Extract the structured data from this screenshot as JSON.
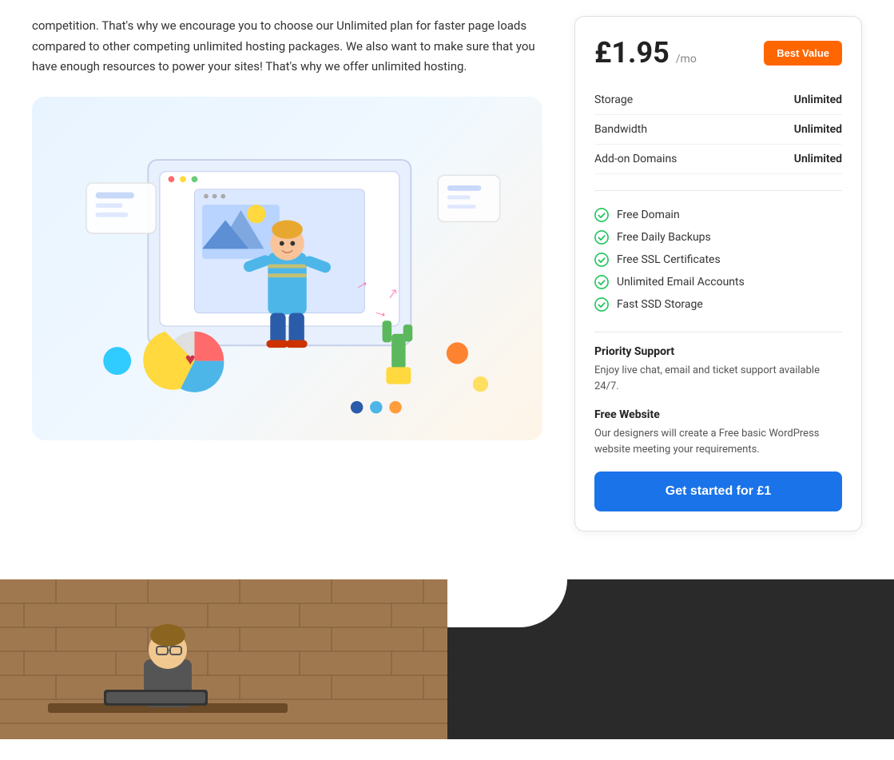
{
  "left": {
    "paragraph": "competition. That's why we encourage you to choose our Unlimited plan for faster page loads compared to other competing unlimited hosting packages. We also want to make sure that you have enough resources to power your sites! That's why we offer unlimited hosting."
  },
  "pricing": {
    "price": "£1.95",
    "period": "/mo",
    "tag_label": "Best Value",
    "specs": [
      {
        "label": "Storage",
        "value": "Unlimited"
      },
      {
        "label": "Bandwidth",
        "value": "Unlimited"
      },
      {
        "label": "Add-on Domains",
        "value": "Unlimited"
      }
    ],
    "features": [
      "Free Domain",
      "Free Daily Backups",
      "Free SSL Certificates",
      "Unlimited Email Accounts",
      "Fast SSD Storage"
    ],
    "priority_support": {
      "title": "Priority Support",
      "description": "Enjoy live chat, email and ticket support available 24/7."
    },
    "free_website": {
      "title": "Free Website",
      "description": "Our designers will create a Free basic WordPress website meeting your requirements."
    },
    "cta_label": "Get started for £1"
  },
  "icons": {
    "check": "✓"
  }
}
